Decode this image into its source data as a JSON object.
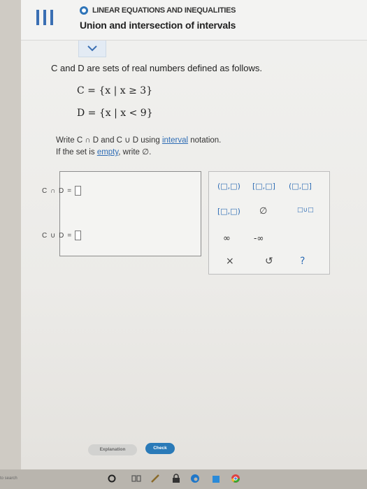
{
  "header": {
    "topic": "LINEAR EQUATIONS AND INEQUALITIES",
    "title": "Union and intersection of intervals"
  },
  "problem": {
    "intro_pre": "C and D are sets of real numbers defined as follows.",
    "set_c": "C = {x | x ≥ 3}",
    "set_d": "D = {x | x < 9}",
    "instruction_1_pre": "Write C ∩ D and C ∪ D using ",
    "instruction_1_link": "interval",
    "instruction_1_post": " notation.",
    "instruction_2_pre": "If the set is ",
    "instruction_2_link": "empty",
    "instruction_2_post": ", write ∅."
  },
  "answers": {
    "intersection_label": "C ∩ D",
    "union_label": "C ∪ D",
    "equals": "="
  },
  "palette": {
    "open_open": "(□,□)",
    "closed_closed": "[□,□]",
    "open_closed": "(□,□]",
    "closed_open": "[□,□)",
    "empty_set": "∅",
    "union": "□∪□",
    "infinity": "∞",
    "neg_infinity": "-∞",
    "clear": "×",
    "undo": "↺",
    "help": "?"
  },
  "buttons": {
    "explanation": "Explanation",
    "check": "Check"
  },
  "taskbar": {
    "search": "to search"
  },
  "colors": {
    "accent": "#2f6db5",
    "check_button": "#2a7ab8"
  }
}
